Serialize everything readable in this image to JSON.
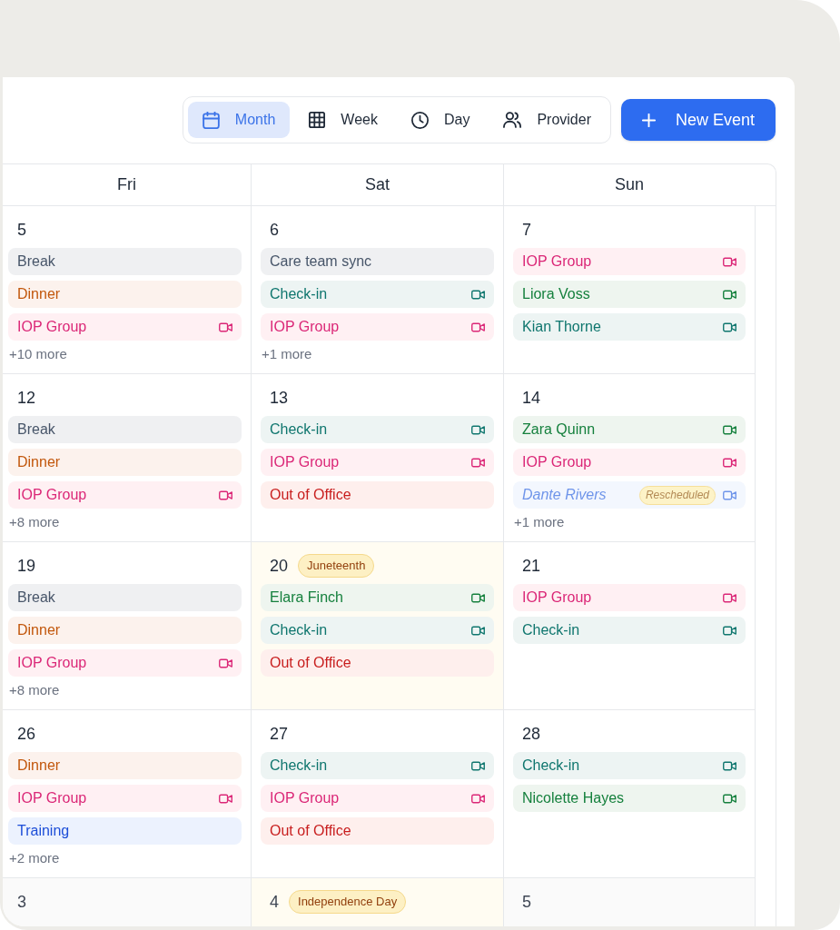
{
  "toolbar": {
    "views": [
      {
        "label": "Month",
        "selected": true
      },
      {
        "label": "Week",
        "selected": false
      },
      {
        "label": "Day",
        "selected": false
      },
      {
        "label": "Provider",
        "selected": false
      }
    ],
    "new_event_button": {
      "label": "New Event"
    }
  },
  "calendar": {
    "columns": [
      {
        "label": "Fri"
      },
      {
        "label": "Sat"
      },
      {
        "label": "Sun"
      }
    ],
    "weeks": [
      {
        "days": [
          {
            "day": "5",
            "in_month": true,
            "events": [
              {
                "title": "Break",
                "color": "#475569",
                "video": false,
                "rescheduled": false
              },
              {
                "title": "Dinner",
                "color": "#c2570c",
                "video": false,
                "rescheduled": false
              },
              {
                "title": "IOP Group",
                "color": "#db2777",
                "video": true,
                "rescheduled": false
              }
            ],
            "more": "+10 more"
          },
          {
            "day": "6",
            "in_month": true,
            "events": [
              {
                "title": "Care team sync",
                "color": "#475569",
                "video": false,
                "rescheduled": false
              },
              {
                "title": "Check-in",
                "color": "#0f766e",
                "video": true,
                "rescheduled": false
              },
              {
                "title": "IOP Group",
                "color": "#db2777",
                "video": true,
                "rescheduled": false
              }
            ],
            "more": "+1 more"
          },
          {
            "day": "7",
            "in_month": true,
            "events": [
              {
                "title": "IOP Group",
                "color": "#db2777",
                "video": true,
                "rescheduled": false
              },
              {
                "title": "Liora Voss",
                "color": "#15803d",
                "video": true,
                "rescheduled": false
              },
              {
                "title": "Kian Thorne",
                "color": "#0f766e",
                "video": true,
                "rescheduled": false
              }
            ]
          }
        ]
      },
      {
        "days": [
          {
            "day": "12",
            "in_month": true,
            "events": [
              {
                "title": "Break",
                "color": "#475569",
                "video": false,
                "rescheduled": false
              },
              {
                "title": "Dinner",
                "color": "#c2570c",
                "video": false,
                "rescheduled": false
              },
              {
                "title": "IOP Group",
                "color": "#db2777",
                "video": true,
                "rescheduled": false
              }
            ],
            "more": "+8 more"
          },
          {
            "day": "13",
            "in_month": true,
            "events": [
              {
                "title": "Check-in",
                "color": "#0f766e",
                "video": true,
                "rescheduled": false
              },
              {
                "title": "IOP Group",
                "color": "#db2777",
                "video": true,
                "rescheduled": false
              },
              {
                "title": "Out of Office",
                "color": "#c81e1e",
                "video": false,
                "rescheduled": false
              }
            ]
          },
          {
            "day": "14",
            "in_month": true,
            "events": [
              {
                "title": "Zara Quinn",
                "color": "#15803d",
                "video": true,
                "rescheduled": false
              },
              {
                "title": "IOP Group",
                "color": "#db2777",
                "video": true,
                "rescheduled": false
              },
              {
                "title": "Dante Rivers",
                "color": "#6f95ea",
                "video": true,
                "rescheduled": true,
                "badge": "Rescheduled"
              }
            ],
            "more": "+1 more"
          }
        ]
      },
      {
        "days": [
          {
            "day": "19",
            "in_month": true,
            "events": [
              {
                "title": "Break",
                "color": "#475569",
                "video": false,
                "rescheduled": false
              },
              {
                "title": "Dinner",
                "color": "#c2570c",
                "video": false,
                "rescheduled": false
              },
              {
                "title": "IOP Group",
                "color": "#db2777",
                "video": true,
                "rescheduled": false
              }
            ],
            "more": "+8 more"
          },
          {
            "day": "20",
            "in_month": true,
            "holiday": "Juneteenth",
            "events": [
              {
                "title": "Elara Finch",
                "color": "#15803d",
                "video": true,
                "rescheduled": false
              },
              {
                "title": "Check-in",
                "color": "#0f766e",
                "video": true,
                "rescheduled": false
              },
              {
                "title": "Out of Office",
                "color": "#c81e1e",
                "video": false,
                "rescheduled": false
              }
            ]
          },
          {
            "day": "21",
            "in_month": true,
            "events": [
              {
                "title": "IOP Group",
                "color": "#db2777",
                "video": true,
                "rescheduled": false
              },
              {
                "title": "Check-in",
                "color": "#0f766e",
                "video": true,
                "rescheduled": false
              }
            ]
          }
        ]
      },
      {
        "days": [
          {
            "day": "26",
            "in_month": true,
            "events": [
              {
                "title": "Dinner",
                "color": "#c2570c",
                "video": false,
                "rescheduled": false
              },
              {
                "title": "IOP Group",
                "color": "#db2777",
                "video": true,
                "rescheduled": false
              },
              {
                "title": "Training",
                "color": "#1d4ed8",
                "video": false,
                "rescheduled": false
              }
            ],
            "more": "+2 more"
          },
          {
            "day": "27",
            "in_month": true,
            "events": [
              {
                "title": "Check-in",
                "color": "#0f766e",
                "video": true,
                "rescheduled": false
              },
              {
                "title": "IOP Group",
                "color": "#db2777",
                "video": true,
                "rescheduled": false
              },
              {
                "title": "Out of Office",
                "color": "#c81e1e",
                "video": false,
                "rescheduled": false
              }
            ]
          },
          {
            "day": "28",
            "in_month": true,
            "events": [
              {
                "title": "Check-in",
                "color": "#0f766e",
                "video": true,
                "rescheduled": false
              },
              {
                "title": "Nicolette Hayes",
                "color": "#15803d",
                "video": true,
                "rescheduled": false
              }
            ]
          }
        ]
      },
      {
        "days": [
          {
            "day": "3",
            "in_month": false
          },
          {
            "day": "4",
            "in_month": false,
            "holiday": "Independence Day"
          },
          {
            "day": "5",
            "in_month": false
          }
        ]
      }
    ]
  }
}
